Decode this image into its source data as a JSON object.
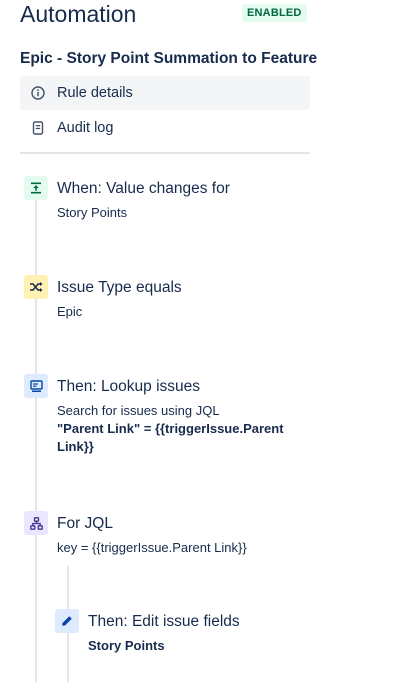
{
  "header": {
    "title": "Automation",
    "status_badge": "ENABLED"
  },
  "rule": {
    "name": "Epic - Story Point Summation to Feature"
  },
  "nav": [
    {
      "label": "Rule details",
      "icon": "info-icon",
      "active": true
    },
    {
      "label": "Audit log",
      "icon": "document-icon",
      "active": false
    }
  ],
  "steps": {
    "trigger": {
      "icon": "value-change-icon",
      "title": "When: Value changes for",
      "subtitle": "Story Points"
    },
    "condition": {
      "icon": "shuffle-icon",
      "title": "Issue Type equals",
      "subtitle": "Epic"
    },
    "lookup": {
      "icon": "lookup-issues-icon",
      "title": "Then: Lookup issues",
      "subtitle": "Search for issues using JQL",
      "jql_bold": "\"Parent Link\" = {{triggerIssue.Parent Link}}"
    },
    "branch": {
      "icon": "branch-icon",
      "title": "For JQL",
      "subtitle": "key = {{triggerIssue.Parent Link}}"
    },
    "edit": {
      "icon": "pencil-icon",
      "title": "Then: Edit issue fields",
      "subtitle": "Story Points"
    }
  },
  "colors": {
    "trigger_bg": "#e3fcef",
    "trigger_fg": "#006644",
    "condition_bg": "#fff0b3",
    "condition_fg": "#172b4d",
    "action_bg": "#deebff",
    "action_fg": "#0747a6",
    "branch_bg": "#eae6ff",
    "branch_fg": "#403294"
  }
}
